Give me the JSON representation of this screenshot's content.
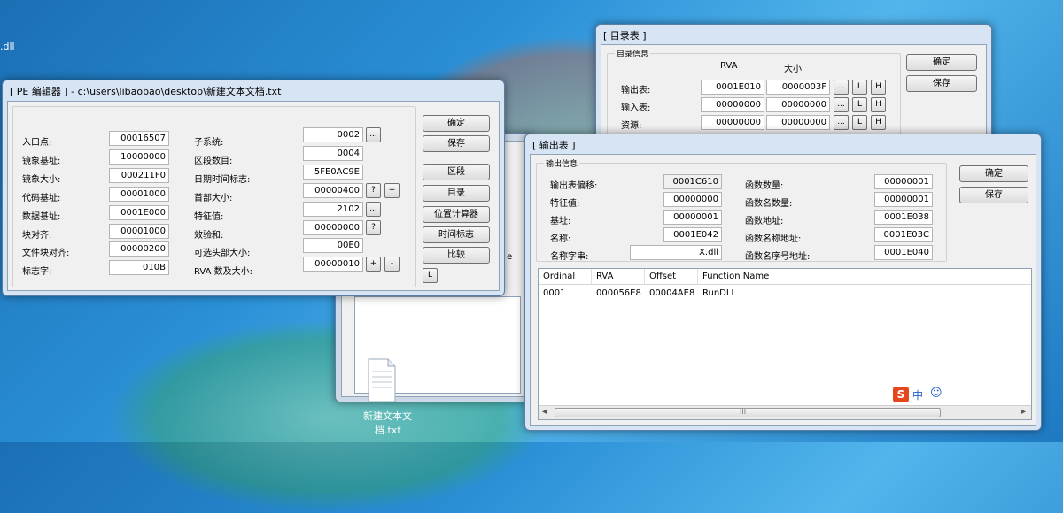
{
  "desktop": {
    "dll_label": ".dll",
    "file_label_line1": "新建文本文",
    "file_label_line2": "档.txt"
  },
  "pe_editor": {
    "title": "[ PE 编辑器 ] - c:\\users\\libaobao\\desktop\\新建文本文档.txt",
    "left": [
      {
        "label": "入口点:",
        "value": "00016507"
      },
      {
        "label": "镜象基址:",
        "value": "10000000"
      },
      {
        "label": "镜象大小:",
        "value": "000211F0"
      },
      {
        "label": "代码基址:",
        "value": "00001000"
      },
      {
        "label": "数据基址:",
        "value": "0001E000"
      },
      {
        "label": "块对齐:",
        "value": "00001000"
      },
      {
        "label": "文件块对齐:",
        "value": "00000200"
      },
      {
        "label": "标志字:",
        "value": "010B"
      }
    ],
    "right": [
      {
        "label": "子系统:",
        "value": "0002"
      },
      {
        "label": "区段数目:",
        "value": "0004"
      },
      {
        "label": "日期时间标志:",
        "value": "5FE0AC9E"
      },
      {
        "label": "首部大小:",
        "value": "00000400"
      },
      {
        "label": "特征值:",
        "value": "2102"
      },
      {
        "label": "效验和:",
        "value": "00000000"
      },
      {
        "label": "可选头部大小:",
        "value": "00E0"
      },
      {
        "label": "RVA 数及大小:",
        "value": "00000010"
      }
    ],
    "buttons": [
      "确定",
      "保存",
      "区段",
      "目录",
      "位置计算器",
      "时间标志",
      "比较"
    ],
    "small": {
      "ellipsis": "...",
      "question": "?",
      "plus": "+",
      "minus": "-",
      "L": "L"
    }
  },
  "directory": {
    "title": "[ 目录表 ]",
    "group_title": "目录信息",
    "col_rva": "RVA",
    "col_size": "大小",
    "rows": [
      {
        "label": "输出表:",
        "rva": "0001E010",
        "size": "0000003F"
      },
      {
        "label": "输入表:",
        "rva": "00000000",
        "size": "00000000"
      },
      {
        "label": "资源:",
        "rva": "00000000",
        "size": "00000000"
      }
    ],
    "buttons": [
      "确定",
      "保存"
    ],
    "small": {
      "ellipsis": "...",
      "L": "L",
      "H": "H"
    }
  },
  "back_window": {
    "partial_text": "e"
  },
  "export": {
    "title": "[ 输出表 ]",
    "group_title": "输出信息",
    "left": [
      {
        "label": "输出表偏移:",
        "value": "0001C610"
      },
      {
        "label": "特征值:",
        "value": "00000000"
      },
      {
        "label": "基址:",
        "value": "00000001"
      },
      {
        "label": "名称:",
        "value": "0001E042"
      },
      {
        "label": "名称字串:",
        "value": "X.dll"
      }
    ],
    "right": [
      {
        "label": "函数数量:",
        "value": "00000001"
      },
      {
        "label": "函数名数量:",
        "value": "00000001"
      },
      {
        "label": "函数地址:",
        "value": "0001E038"
      },
      {
        "label": "函数名称地址:",
        "value": "0001E03C"
      },
      {
        "label": "函数名序号地址:",
        "value": "0001E040"
      }
    ],
    "buttons": [
      "确定",
      "保存"
    ],
    "table": {
      "headers": [
        "Ordinal",
        "RVA",
        "Offset",
        "Function Name"
      ],
      "rows": [
        [
          "0001",
          "000056E8",
          "00004AE8",
          "RunDLL"
        ]
      ]
    },
    "ime": {
      "logo": "S",
      "mode": "中",
      "emoji": "☺"
    },
    "scroll": {
      "left": "◂",
      "right": "▸",
      "thumb": "III"
    }
  }
}
